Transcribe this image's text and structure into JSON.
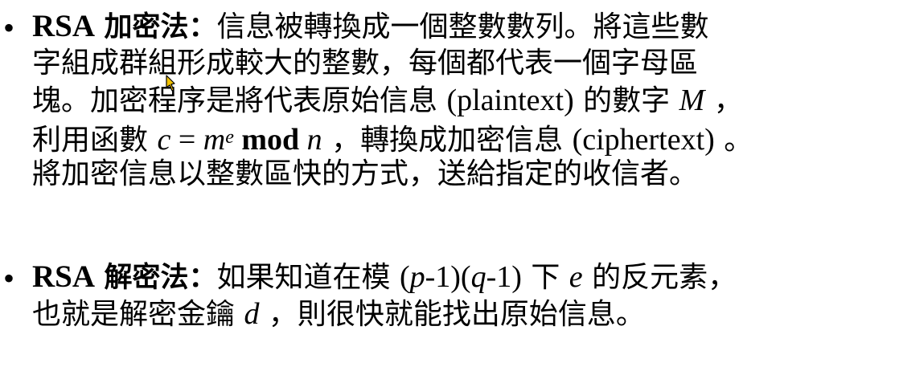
{
  "rsa_encryption": {
    "bullet": "•",
    "term": "RSA",
    "term_cjk": "加密法：",
    "lines": [
      {
        "a": "信息被轉換成一個整數數列。將這些數"
      },
      {
        "a": "字組成群組形成較大的整數，每個都代表一個字母區"
      },
      {
        "a": "塊。加密程序是將代表原始信息 ",
        "latin": "(plaintext)",
        "b": " 的數字 ",
        "math": "M",
        "c": " ，"
      },
      {
        "a": "利用函數 ",
        "math_c": "c",
        "eq": " = ",
        "math_m": "m",
        "sup_e": "e",
        "mod": " mod ",
        "math_n": "n",
        "b": " ，轉換成加密信息 ",
        "latin": "(ciphertext)",
        "c": "  。"
      },
      {
        "a": "將加密信息以整數區快的方式，送給指定的收信者。"
      }
    ]
  },
  "rsa_decryption": {
    "bullet": "•",
    "term": "RSA",
    "term_cjk": "解密法：",
    "lines": [
      {
        "a": "如果知道在模 ",
        "latin_open": "(",
        "math_p": "p",
        "latin_mid": "-1)(",
        "math_q": "q",
        "latin_close": "-1)",
        "b": " 下 ",
        "math_e": "e",
        "c": " 的反元素，"
      },
      {
        "a": "也就是解密金鑰 ",
        "math_d": "d",
        "b": " ，則很快就能找出原始信息。"
      }
    ]
  },
  "icons": {
    "cursor": "pen-cursor-icon",
    "cursor_color": "#f2c200"
  }
}
